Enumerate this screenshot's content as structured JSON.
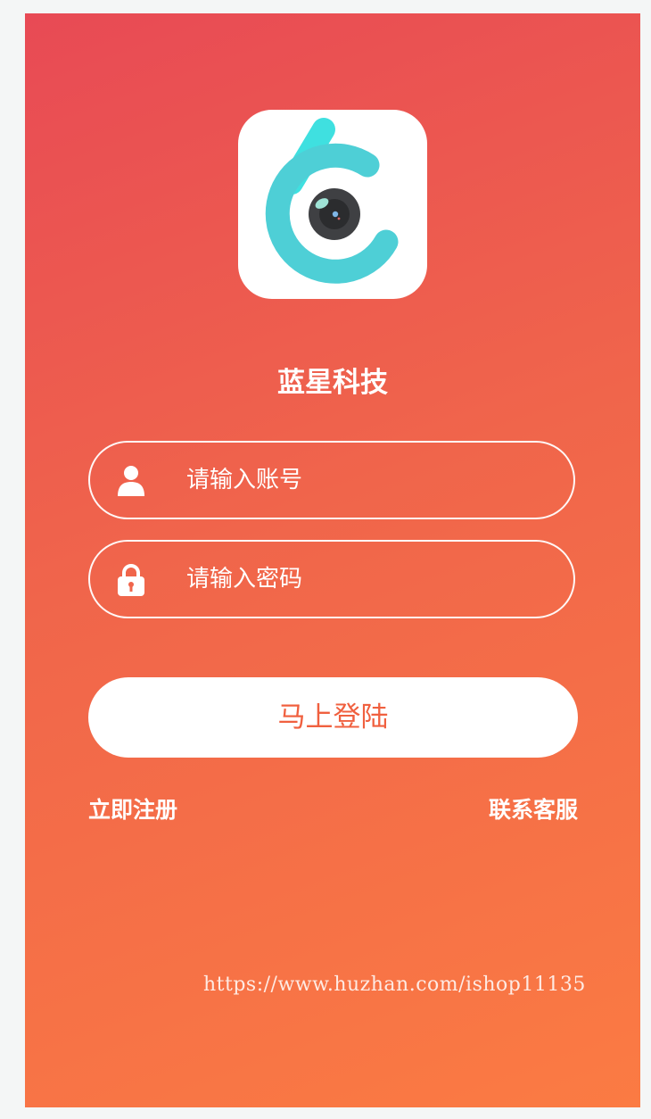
{
  "app": {
    "name": "蓝星科技",
    "logo_icon": "camera-c-logo-icon"
  },
  "form": {
    "username_placeholder": "请输入账号",
    "password_placeholder": "请输入密码",
    "username_icon": "user-icon",
    "password_icon": "lock-icon",
    "submit_label": "马上登陆"
  },
  "links": {
    "register": "立即注册",
    "support": "联系客服"
  },
  "watermark": "https://www.huzhan.com/ishop11135",
  "colors": {
    "gradient_top": "#e84a55",
    "gradient_bottom": "#fb7b43",
    "logo_teal": "#4ecfd6",
    "logo_teal_light": "#3fe0e0",
    "button_text": "#f0603f"
  }
}
